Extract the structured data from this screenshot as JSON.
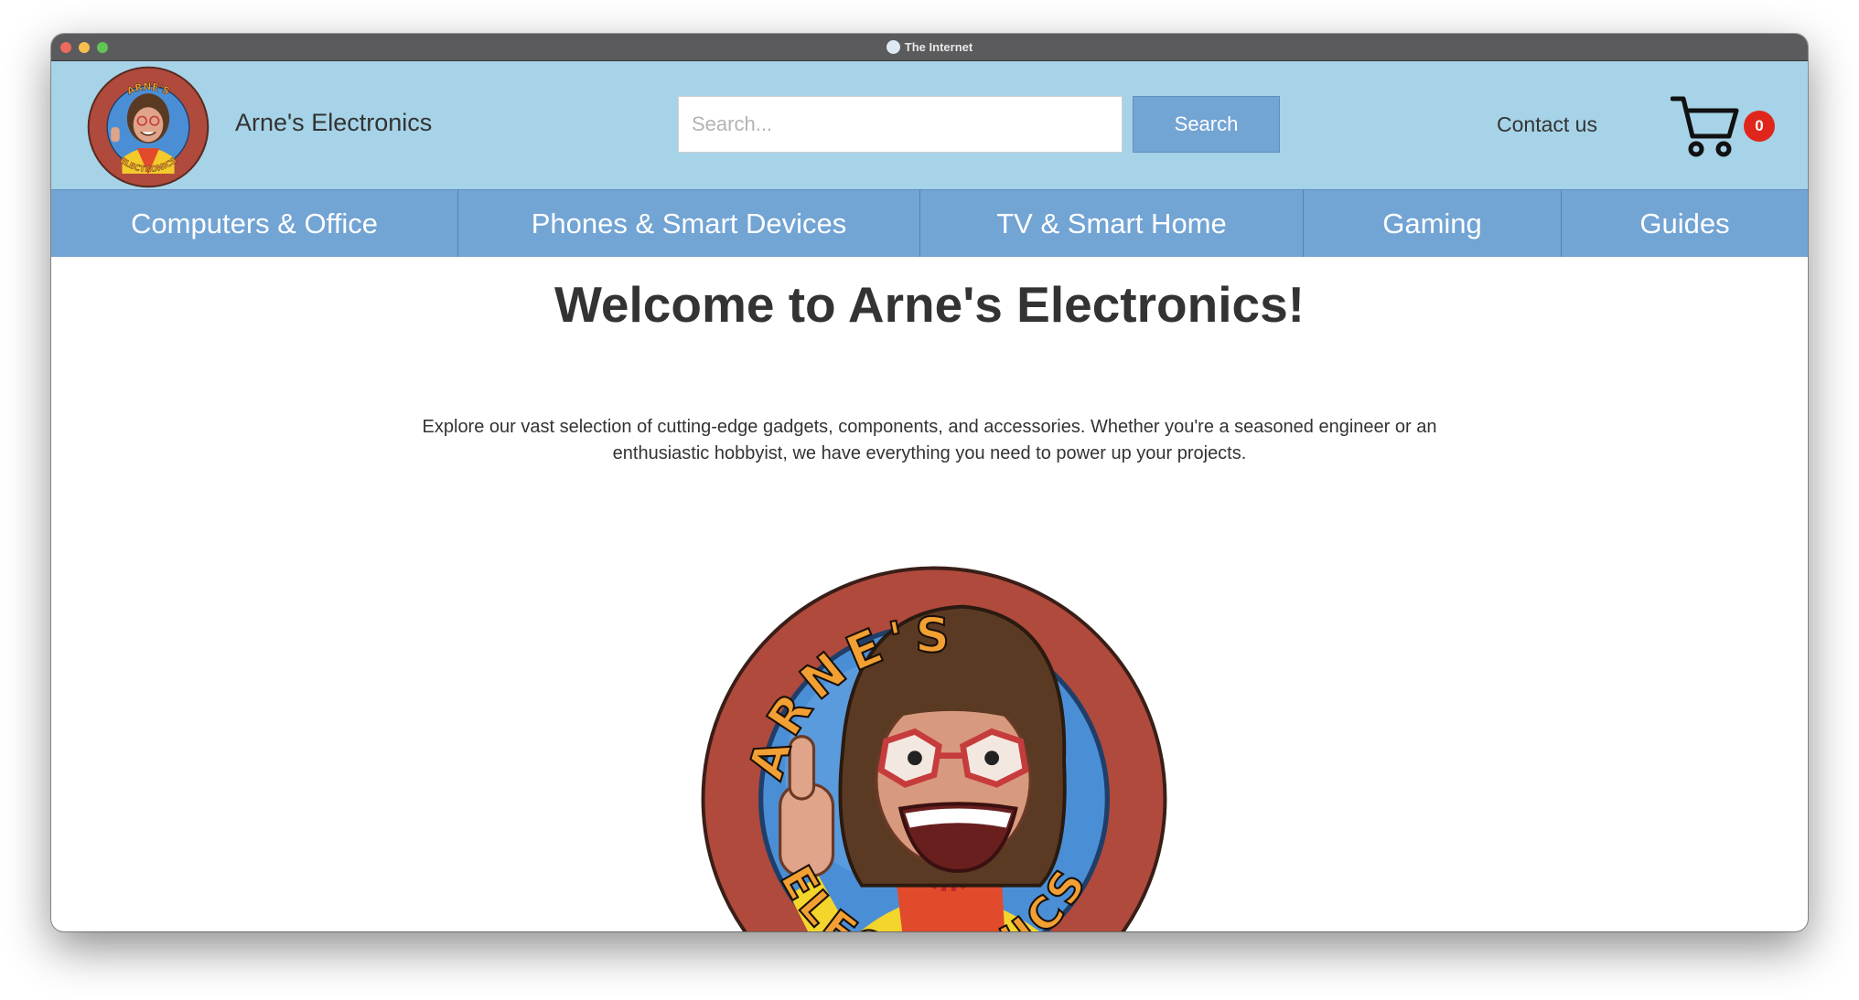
{
  "browser": {
    "title": "The Internet"
  },
  "header": {
    "brand_name": "Arne's Electronics",
    "logo_icon": "arnes-electronics-logo",
    "search": {
      "placeholder": "Search...",
      "value": "",
      "button_label": "Search"
    },
    "contact_label": "Contact us",
    "cart": {
      "icon": "shopping-cart-icon",
      "count": "0"
    }
  },
  "nav": {
    "items": [
      {
        "label": "Computers & Office"
      },
      {
        "label": "Phones & Smart Devices"
      },
      {
        "label": "TV & Smart Home"
      },
      {
        "label": "Gaming"
      },
      {
        "label": "Guides"
      }
    ]
  },
  "main": {
    "heading": "Welcome to Arne's Electronics!",
    "intro": "Explore our vast selection of cutting-edge gadgets, components, and accessories. Whether you're a seasoned engineer or an enthusiastic hobbyist, we have everything you need to power up your projects.",
    "hero_image": "arnes-electronics-mascot-logo",
    "logo_text_top": "ARNE'S",
    "logo_text_bottom": "ELECTRONICS"
  },
  "colors": {
    "header_bg": "#a6d3e7",
    "nav_bg": "#72a4d4",
    "button_bg": "#72a4d4",
    "badge_bg": "#e0261b",
    "logo_ring": "#b04a3c",
    "logo_inner": "#4a8fd6",
    "text": "#333333"
  }
}
